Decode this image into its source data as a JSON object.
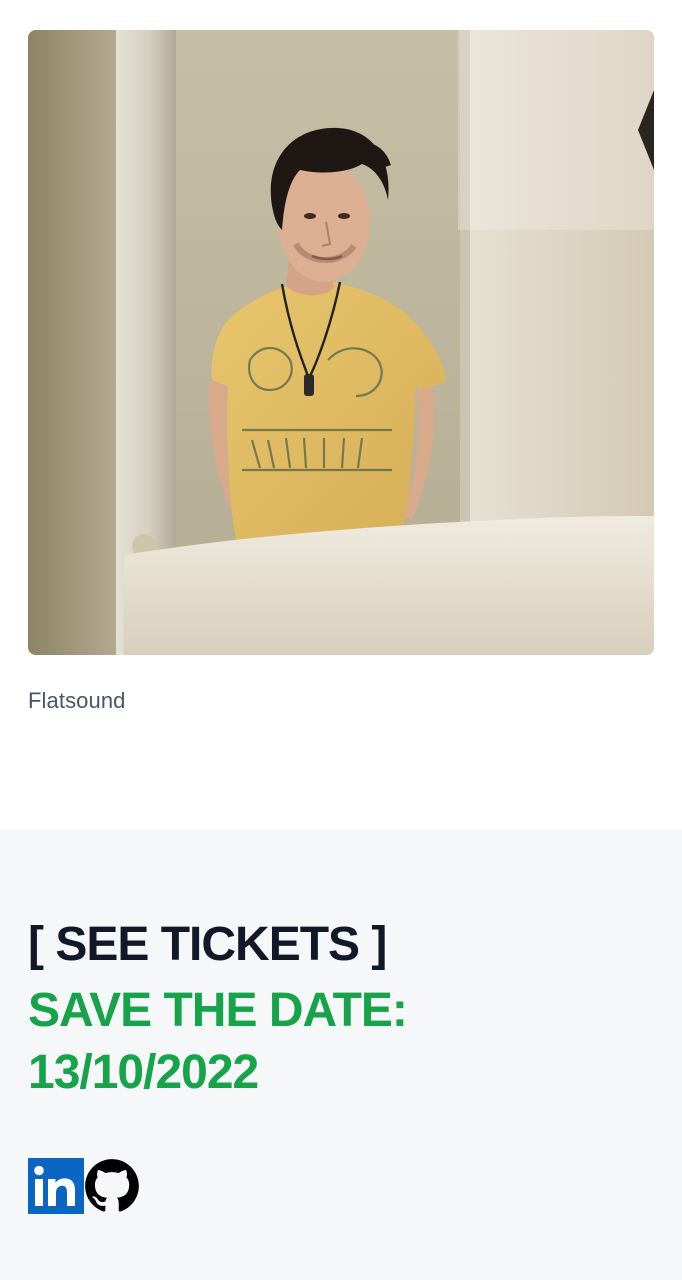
{
  "artist": {
    "caption": "Flatsound",
    "photo_alt": "Photo of Flatsound"
  },
  "cta": {
    "tickets_label": "[ SEE TICKETS ]",
    "save_line1": "SAVE THE DATE:",
    "save_line2": "13/10/2022"
  },
  "social": [
    {
      "name": "LinkedIn",
      "icon": "linkedin-icon",
      "color": "#0a66c2"
    },
    {
      "name": "GitHub",
      "icon": "github-icon",
      "color": "#000000"
    }
  ],
  "colors": {
    "accent_green": "#16a34a",
    "heading_dark": "#111827",
    "footer_bg": "#f6f7f9"
  }
}
